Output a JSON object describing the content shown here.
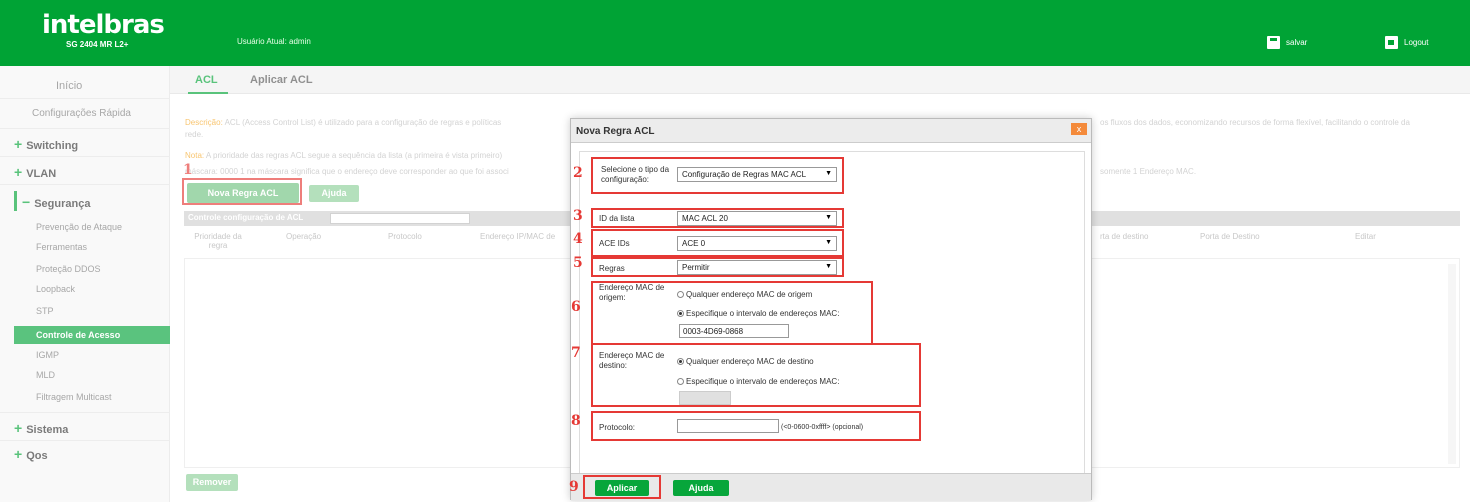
{
  "header": {
    "logo": "intelbras",
    "model": "SG 2404 MR L2+",
    "user_text": "Usuário Atual: admin",
    "save_label": "salvar",
    "logout_label": "Logout"
  },
  "sidebar": {
    "inicio": "Início",
    "config_rapida": "Configurações Rápida",
    "switching": "Switching",
    "vlan": "VLAN",
    "seguranca": "Segurança",
    "seg_items": [
      "Prevenção de Ataque",
      "Ferramentas",
      "Proteção DDOS",
      "Loopback",
      "STP",
      "Controle de Acesso",
      "IGMP",
      "MLD",
      "Filtragem Multicast"
    ],
    "sistema": "Sistema",
    "qos": "Qos"
  },
  "tabs": [
    "ACL",
    "Aplicar ACL"
  ],
  "description": {
    "line1_label": "Descrição:",
    "line1_text": "ACL (Access Control List) é utilizado para a configuração de regras e políticas",
    "line1_tail": "os fluxos dos dados, economizando recursos de forma flexível, facilitando o controle da",
    "line1b": "rede.",
    "line2_label": "Nota:",
    "line2_text": "A prioridade das regras ACL segue a sequência da lista (a primeira é vista primeiro)",
    "line3_text": "máscara: 0000 1 na máscara significa que o endereço deve corresponder ao que foi associ",
    "line3_tail": "somente 1 Endereço MAC."
  },
  "buttons": {
    "nova_regra": "Nova Regra ACL",
    "ajuda": "Ajuda",
    "remover": "Remover"
  },
  "table": {
    "head_label": "Controle configuração de ACL",
    "columns": [
      "Prioridade da regra",
      "Operação",
      "Protocolo",
      "Endereço IP/MAC de",
      "rta de destino",
      "Porta de Destino",
      "Editar"
    ]
  },
  "modal": {
    "title": "Nova Regra ACL",
    "close": "x",
    "tipo_label": "Selecione o tipo da configuração:",
    "tipo_value": "Configuração de Regras MAC ACL",
    "id_lista_label": "ID da lista",
    "id_lista_value": "MAC ACL 20",
    "ace_ids_label": "ACE IDs",
    "ace_ids_value": "ACE 0",
    "regras_label": "Regras",
    "regras_value": "Permitir",
    "mac_origem_label": "Endereço MAC de origem:",
    "mac_origem_opt1": "Qualquer endereço MAC de origem",
    "mac_origem_opt2": "Especifique o intervalo de endereços MAC:",
    "mac_origem_value": "0003-4D69-0868",
    "mac_destino_label": "Endereço MAC de destino:",
    "mac_destino_opt1": "Qualquer endereço MAC de destino",
    "mac_destino_opt2": "Especifique o intervalo de endereços MAC:",
    "protocolo_label": "Protocolo:",
    "protocolo_value": "",
    "protocolo_hint": "(<0-0600-0xffff> (opcional)",
    "aplicar": "Aplicar",
    "ajuda": "Ajuda"
  },
  "annotations": [
    "1",
    "2",
    "3",
    "4",
    "5",
    "6",
    "7",
    "8",
    "9"
  ],
  "colors": {
    "brand_green": "#00a335",
    "annotation_red": "#e53935",
    "button_green": "#07a63b"
  }
}
